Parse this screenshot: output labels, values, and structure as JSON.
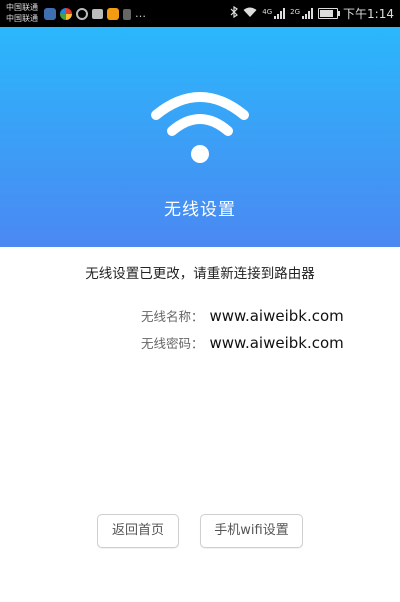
{
  "statusbar": {
    "carrier_1": "中国联通",
    "carrier_2": "中国联通",
    "more": "…",
    "network_1": "4G",
    "network_2": "2G",
    "time": "下午1:14",
    "battery_level": 0.85
  },
  "hero": {
    "icon": "wifi-icon",
    "title": "无线设置",
    "colors": {
      "top": "#2bb7fb",
      "bottom": "#4b88f2"
    }
  },
  "content": {
    "message": "无线设置已更改，请重新连接到路由器",
    "ssid_label": "无线名称：",
    "ssid_value": "www.aiweibk.com",
    "password_label": "无线密码：",
    "password_value": "www.aiweibk.com"
  },
  "buttons": {
    "home_label": "返回首页",
    "phone_wifi_label": "手机wifi设置"
  }
}
